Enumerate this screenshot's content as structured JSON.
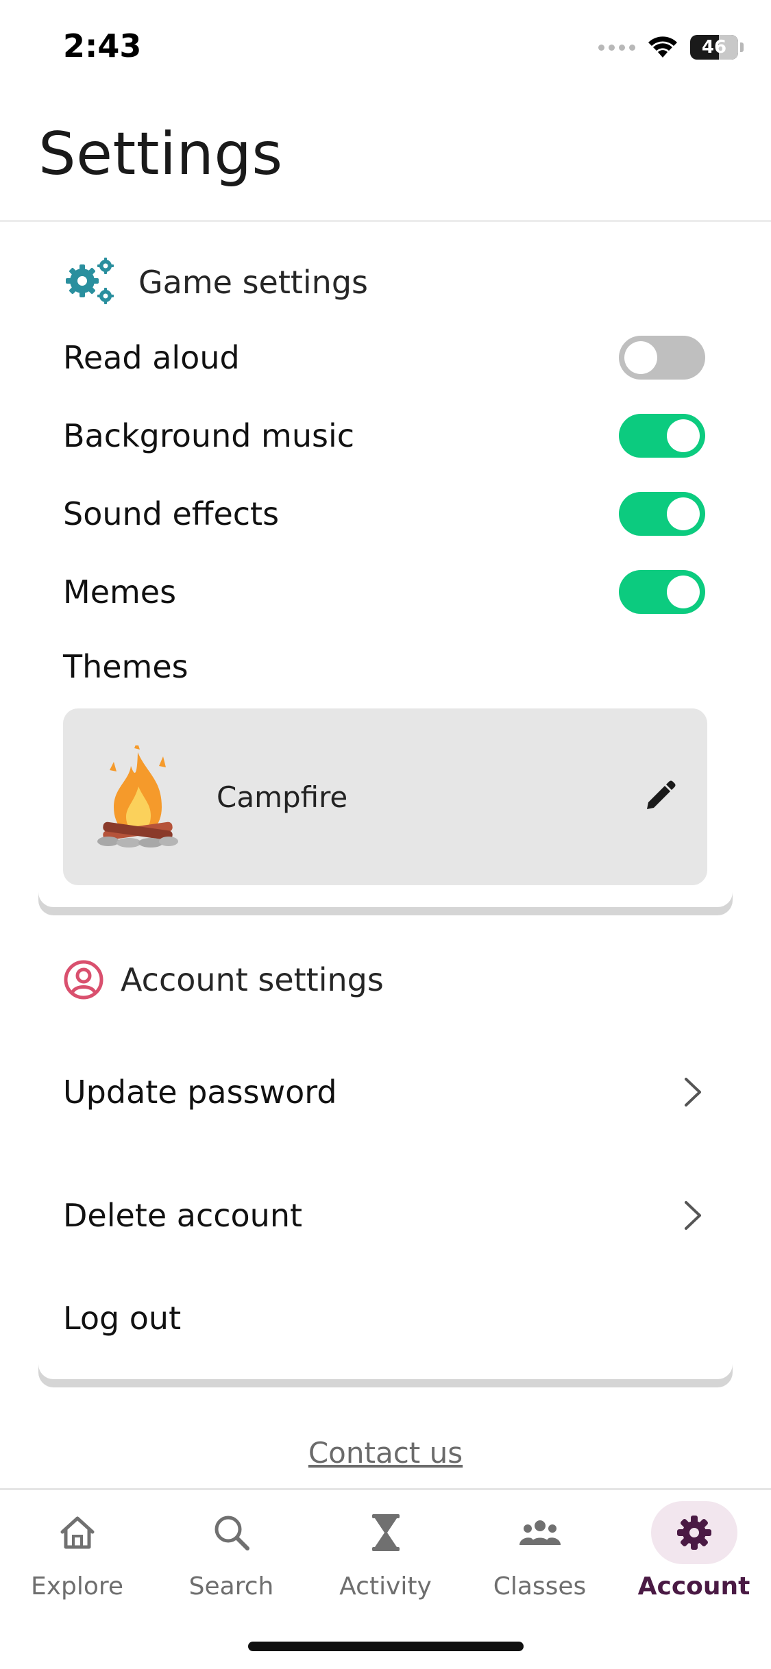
{
  "status_bar": {
    "time": "2:43",
    "battery": "46"
  },
  "header": {
    "title": "Settings"
  },
  "game_settings": {
    "title": "Game settings",
    "icon": "gears-icon",
    "options": [
      {
        "label": "Read aloud",
        "enabled": false
      },
      {
        "label": "Background music",
        "enabled": true
      },
      {
        "label": "Sound effects",
        "enabled": true
      },
      {
        "label": "Memes",
        "enabled": true
      }
    ],
    "themes_label": "Themes",
    "theme": {
      "name": "Campfire",
      "icon": "campfire-icon"
    }
  },
  "account_settings": {
    "title": "Account settings",
    "icon": "user-circle-icon",
    "items": [
      {
        "label": "Update password"
      },
      {
        "label": "Delete account"
      },
      {
        "label": "Log out"
      }
    ]
  },
  "footer": {
    "contact": "Contact us"
  },
  "tabbar": {
    "tabs": [
      {
        "label": "Explore",
        "icon": "home-icon",
        "active": false
      },
      {
        "label": "Search",
        "icon": "search-icon",
        "active": false
      },
      {
        "label": "Activity",
        "icon": "hourglass-icon",
        "active": false
      },
      {
        "label": "Classes",
        "icon": "group-icon",
        "active": false
      },
      {
        "label": "Account",
        "icon": "gear-icon",
        "active": true
      }
    ]
  },
  "colors": {
    "toggle_on": "#0ccb7f",
    "toggle_off": "#bfbfbf",
    "gear_teal": "#2a8f9e",
    "account_pink": "#d9506e",
    "active_tab": "#4a1a44",
    "active_tab_bg": "#f2e6ee"
  }
}
